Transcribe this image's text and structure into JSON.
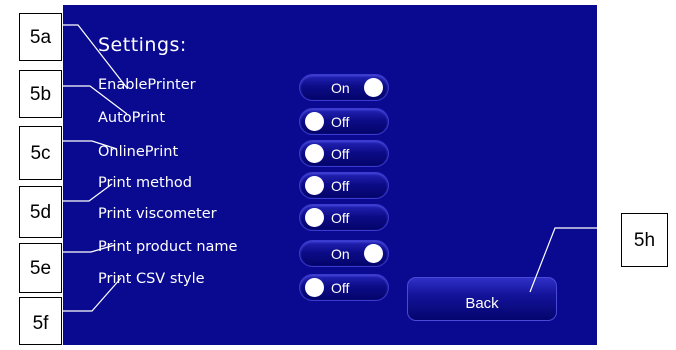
{
  "screen": {
    "title": "Settings:",
    "back_label": "Back",
    "settings": [
      {
        "name": "EnablePrinter",
        "state": "On"
      },
      {
        "name": "AutoPrint",
        "state": "Off"
      },
      {
        "name": "OnlinePrint",
        "state": "Off"
      },
      {
        "name": "Print method",
        "state": "Off"
      },
      {
        "name": "Print viscometer",
        "state": "Off"
      },
      {
        "name": "Print product name",
        "state": "On"
      },
      {
        "name": "Print CSV style",
        "state": "Off"
      }
    ]
  },
  "callouts": [
    "5a",
    "5b",
    "5c",
    "5d",
    "5e",
    "5f",
    "5h"
  ],
  "colors": {
    "screen_bg": "#0a0a91",
    "text": "#ffffff"
  }
}
